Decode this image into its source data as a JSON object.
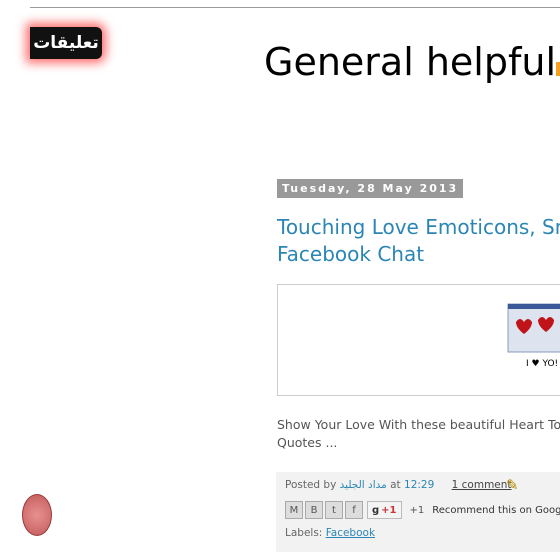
{
  "comments_tab": {
    "label": "تعليقات"
  },
  "blog": {
    "title": "General helpful"
  },
  "post": {
    "date": "Tuesday, 28 May 2013",
    "title_line1": "Touching Love Emoticons, Sn",
    "title_line2": "Facebook Chat",
    "snippet_line1": "Show Your Love With these  beautiful Heart  Tou",
    "snippet_line2": "Quotes ...",
    "image_text": "I ♥ YO!"
  },
  "footer": {
    "posted_by": "Posted by",
    "author": "مداد الجليد",
    "at": "at",
    "time": "12:29",
    "comment_link": "1 comment",
    "share_buttons": [
      "M",
      "B",
      "t",
      "f"
    ],
    "gplus_label": "+1",
    "plus_count": "+1",
    "recommend": "Recommend this on Google",
    "labels_prefix": "Labels:",
    "label": "Facebook"
  }
}
